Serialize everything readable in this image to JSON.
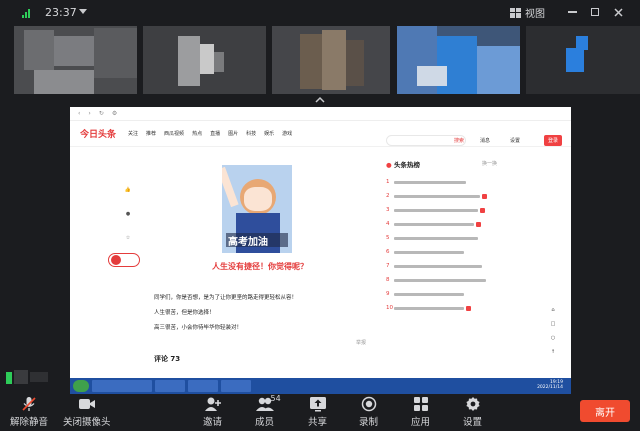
{
  "status": {
    "time": "23:37"
  },
  "window": {
    "view_label": "视图"
  },
  "toolbar": {
    "unmute": "解除静音",
    "camera": "关闭摄像头",
    "invite": "邀请",
    "members": "成员",
    "member_count": "54",
    "share": "共享",
    "record": "录制",
    "apps": "应用",
    "settings": "设置",
    "leave": "离开"
  },
  "shared_screen": {
    "site_logo": "今日头条",
    "nav_items": [
      "关注",
      "推荐",
      "西瓜视频",
      "热点",
      "直播",
      "图片",
      "科技",
      "娱乐",
      "游戏"
    ],
    "search_button": "搜索",
    "message": "消息",
    "settings": "设置",
    "login": "登录",
    "image_caption": "高考加油",
    "article_title": "人生没有捷径！你觉得呢？",
    "paragraphs": [
      "同学们，你是否想，是为了让你更坚的路走得更轻松从容！",
      "人生很苦，但是你选择！",
      "高三很苦，小会你待毕华你轻装对！"
    ],
    "comments_label": "评论 73",
    "report_label": "举报",
    "hot_title": "头条热榜",
    "hot_refresh": "换一换",
    "hot_items": [
      "1",
      "2",
      "3",
      "4",
      "5",
      "6",
      "7",
      "8",
      "9",
      "10"
    ],
    "taskbar_clock": "19:19",
    "taskbar_date": "2022/11/14"
  },
  "colors": {
    "accent_red": "#f04142",
    "leave_button": "#f04b2f",
    "signal_green": "#2ecc59",
    "taskbar_blue": "#1f4fa0"
  }
}
